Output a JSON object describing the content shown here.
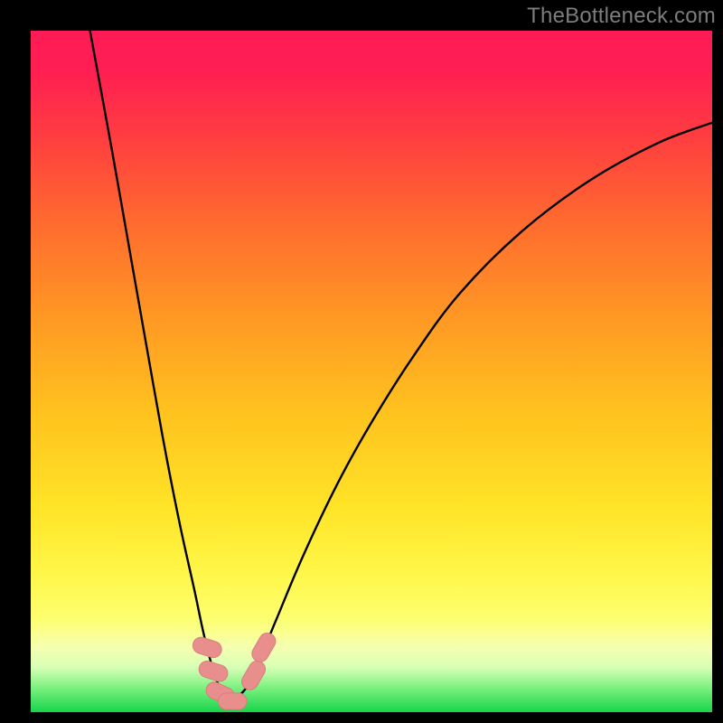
{
  "attribution": "TheBottleneck.com",
  "colors": {
    "frame": "#000000",
    "gradient_stops": [
      {
        "offset": 0.0,
        "color": "#ff1b55"
      },
      {
        "offset": 0.06,
        "color": "#ff1f52"
      },
      {
        "offset": 0.15,
        "color": "#ff3b41"
      },
      {
        "offset": 0.28,
        "color": "#ff6a2f"
      },
      {
        "offset": 0.42,
        "color": "#ff9824"
      },
      {
        "offset": 0.56,
        "color": "#ffc21e"
      },
      {
        "offset": 0.7,
        "color": "#ffe427"
      },
      {
        "offset": 0.8,
        "color": "#fff74a"
      },
      {
        "offset": 0.865,
        "color": "#fdff72"
      },
      {
        "offset": 0.905,
        "color": "#f5ffb0"
      },
      {
        "offset": 0.935,
        "color": "#d6ffb5"
      },
      {
        "offset": 0.965,
        "color": "#7af07f"
      },
      {
        "offset": 1.0,
        "color": "#17d44a"
      }
    ],
    "curve": "#000000",
    "marker_fill": "#e88f8e",
    "marker_stroke": "#d97d7c"
  },
  "chart_data": {
    "type": "line",
    "title": "",
    "xlabel": "",
    "ylabel": "",
    "xlim": [
      0,
      100
    ],
    "ylim": [
      0,
      100
    ],
    "grid": false,
    "legend": false,
    "notes": "V-shaped bottleneck curve. y≈0 is ideal (green), y≈100 is worst (red). Minimum around x≈28.5.",
    "series": [
      {
        "name": "bottleneck-curve",
        "x": [
          8.7,
          12,
          15,
          18,
          20,
          22,
          24,
          25.5,
          27,
          28.5,
          30,
          31.5,
          33,
          36,
          40,
          45,
          50,
          56,
          63,
          72,
          82,
          92,
          100
        ],
        "y": [
          100,
          82,
          65,
          48,
          37,
          27,
          18,
          11,
          5.5,
          2.2,
          2.2,
          3.4,
          6.3,
          13.5,
          23,
          33.5,
          42.5,
          52,
          61.5,
          70.5,
          78,
          83.5,
          86.5
        ]
      }
    ],
    "markers": [
      {
        "shape": "round-rect",
        "cx": 25.9,
        "cy": 9.5,
        "w": 2.4,
        "h": 4.3,
        "angle": -72
      },
      {
        "shape": "round-rect",
        "cx": 26.8,
        "cy": 6.0,
        "w": 2.4,
        "h": 4.3,
        "angle": -72
      },
      {
        "shape": "round-rect",
        "cx": 27.8,
        "cy": 2.8,
        "w": 2.4,
        "h": 4.3,
        "angle": -65
      },
      {
        "shape": "round-rect",
        "cx": 29.6,
        "cy": 1.6,
        "w": 4.2,
        "h": 2.4,
        "angle": 0
      },
      {
        "shape": "round-rect",
        "cx": 32.7,
        "cy": 5.4,
        "w": 2.4,
        "h": 4.5,
        "angle": 30
      },
      {
        "shape": "round-rect",
        "cx": 34.2,
        "cy": 9.5,
        "w": 2.4,
        "h": 4.5,
        "angle": 30
      }
    ]
  }
}
